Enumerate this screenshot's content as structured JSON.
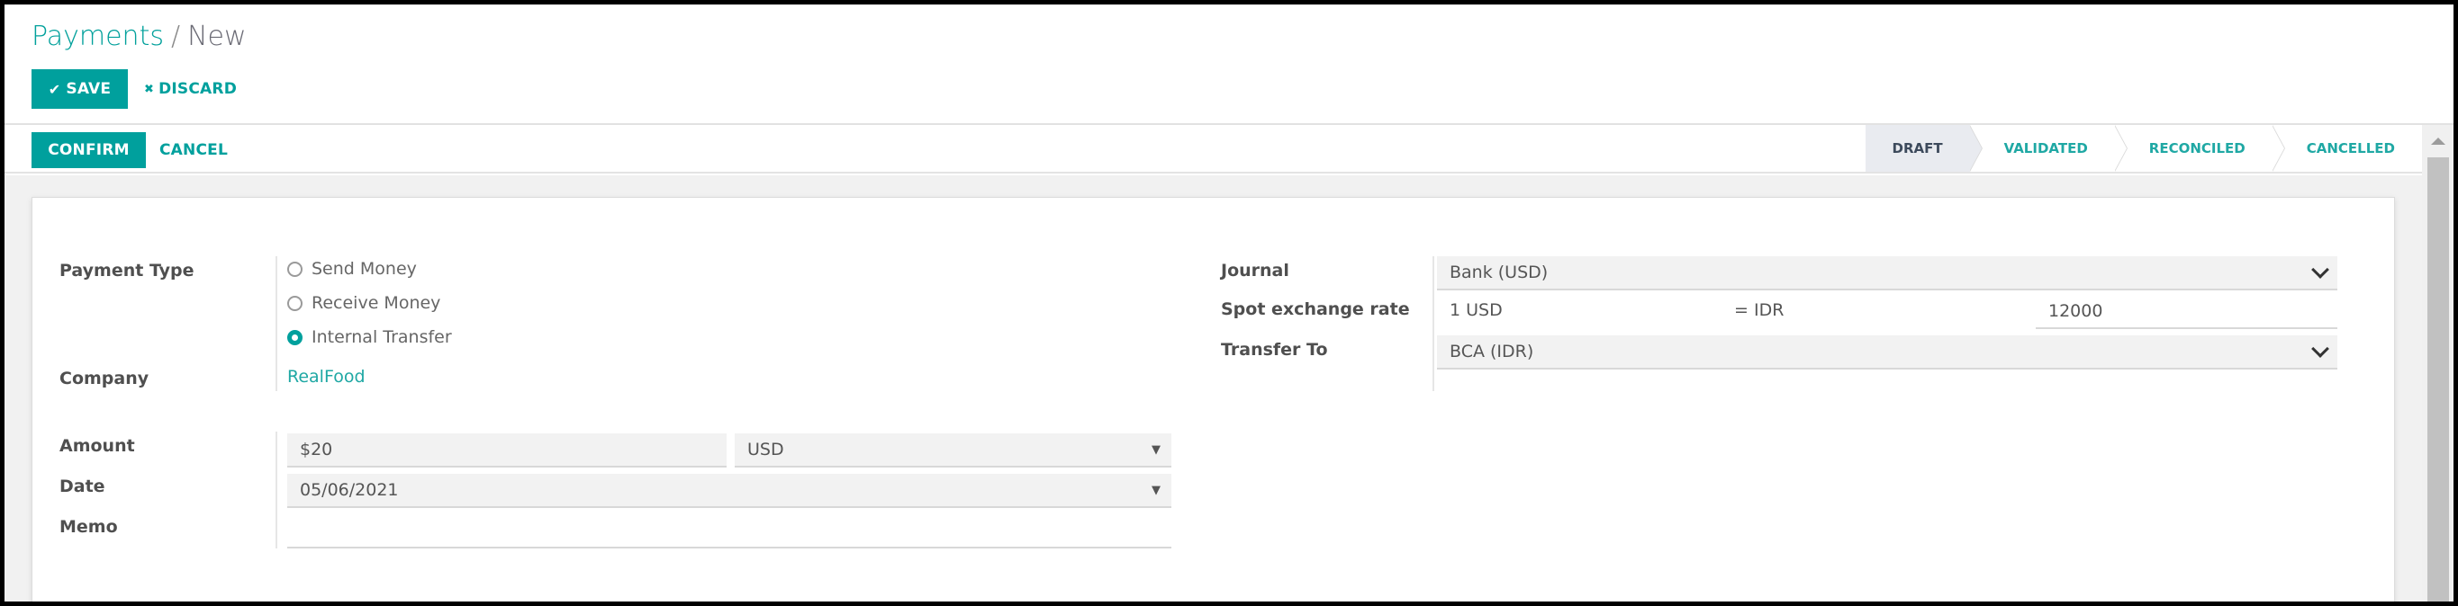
{
  "breadcrumb": {
    "parent": "Payments",
    "separator": "/",
    "current": "New"
  },
  "toolbar": {
    "save_label": "SAVE",
    "save_icon": "✔",
    "discard_label": "DISCARD",
    "discard_icon": "✖"
  },
  "header": {
    "confirm_label": "CONFIRM",
    "cancel_label": "CANCEL",
    "statuses": [
      {
        "label": "DRAFT",
        "active": true
      },
      {
        "label": "VALIDATED",
        "active": false
      },
      {
        "label": "RECONCILED",
        "active": false
      },
      {
        "label": "CANCELLED",
        "active": false
      }
    ]
  },
  "form": {
    "payment_type": {
      "label": "Payment Type",
      "options": [
        {
          "label": "Send Money",
          "checked": false
        },
        {
          "label": "Receive Money",
          "checked": false
        },
        {
          "label": "Internal Transfer",
          "checked": true
        }
      ]
    },
    "company": {
      "label": "Company",
      "value": "RealFood"
    },
    "amount": {
      "label": "Amount",
      "value": "$20",
      "currency": "USD"
    },
    "date": {
      "label": "Date",
      "value": "05/06/2021"
    },
    "memo": {
      "label": "Memo",
      "value": ""
    },
    "journal": {
      "label": "Journal",
      "value": "Bank (USD)"
    },
    "spot_rate": {
      "label": "Spot exchange rate",
      "from": "1 USD",
      "to": "= IDR",
      "value": "12000"
    },
    "transfer_to": {
      "label": "Transfer To",
      "value": "BCA (IDR)"
    }
  },
  "colors": {
    "brand": "#00a09d",
    "active_status_bg": "#e9ebf0"
  }
}
